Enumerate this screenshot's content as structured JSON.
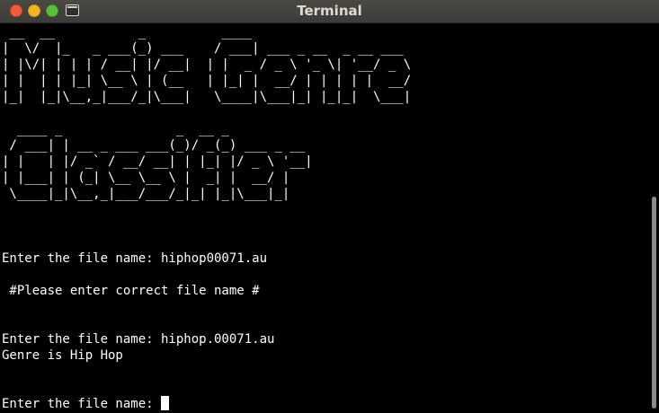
{
  "window": {
    "title": "Terminal",
    "icons": {
      "close": "close-icon",
      "minimize": "minimize-icon",
      "maximize": "maximize-icon",
      "app": "terminal-icon"
    }
  },
  "terminal": {
    "banner": " __  __           _          ____                      \n|  \\/  |_   _ ___(_) ___    / ___| ___ _ __  _ __ ___ \n| |\\/| | | | / __| |/ __|  | |  _ / _ \\ '_ \\| '__/ _ \\\n| |  | | |_| \\__ \\ | (__   | |_| |  __/ | | | | |  __/\n|_|  |_|\\__,_|___/_|\\___|   \\____|\\___|_| |_|_|  \\___|\n\n  ____ _               _  __ _\n / ___| | __ _ ___ ___(_)/ _(_) ___ _ __\n| |   | |/ _` / __/ __| | |_| |/ _ \\ '__|\n| |___| | (_| \\__ \\__ \\ |  _| |  __/ |\n \\____|_|\\__,_|___/___/_|_| |_|\\___|_|",
    "lines": [
      "Enter the file name: hiphop00071.au",
      " #Please enter correct file name #",
      "Enter the file name: hiphop.00071.au",
      "Genre is Hip Hop",
      "Enter the file name: "
    ]
  }
}
